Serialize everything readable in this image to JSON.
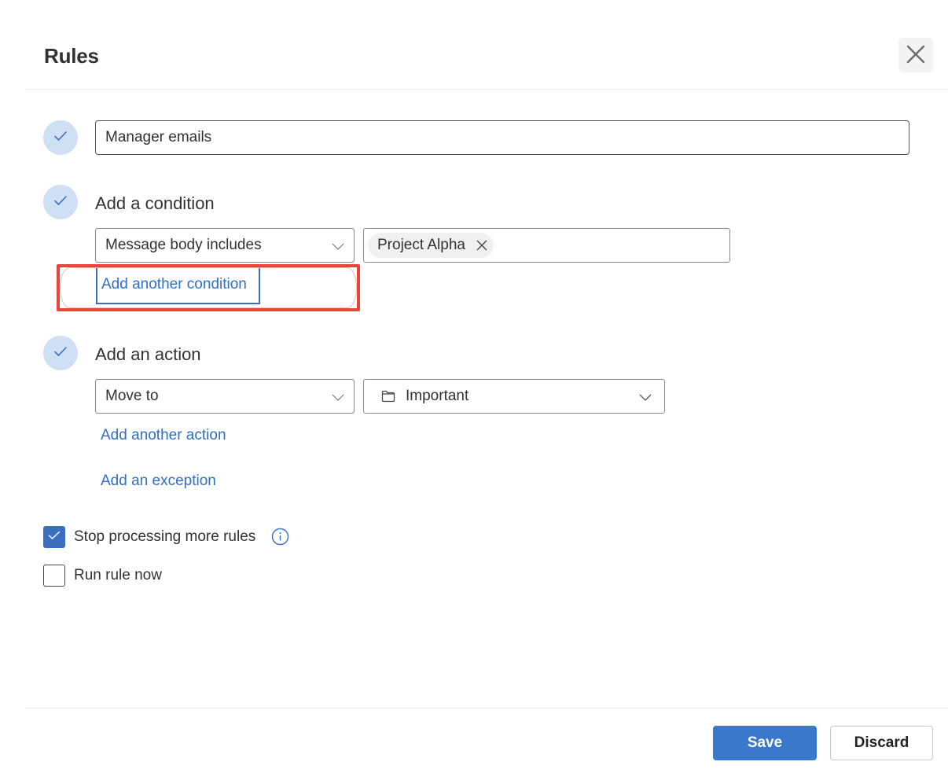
{
  "dialog": {
    "title": "Rules",
    "close_icon": "close-icon"
  },
  "rule_name": {
    "value": "Manager emails",
    "step_icon": "checkmark-icon"
  },
  "condition": {
    "label": "Add a condition",
    "type_dropdown": "Message body includes",
    "tags": [
      "Project Alpha"
    ],
    "add_another": "Add another condition"
  },
  "action": {
    "label": "Add an action",
    "type_dropdown": "Move to",
    "folder_dropdown": "Important",
    "folder_icon": "folder-icon",
    "add_another": "Add another action",
    "add_exception": "Add an exception"
  },
  "options": {
    "stop_processing": {
      "label": "Stop processing more rules",
      "checked": true
    },
    "run_now": {
      "label": "Run rule now",
      "checked": false
    }
  },
  "footer": {
    "save": "Save",
    "discard": "Discard"
  },
  "colors": {
    "accent": "#3a78cc",
    "link": "#2f6fc4",
    "step_circle": "#cfe0f5",
    "highlight": "#e8443a"
  }
}
